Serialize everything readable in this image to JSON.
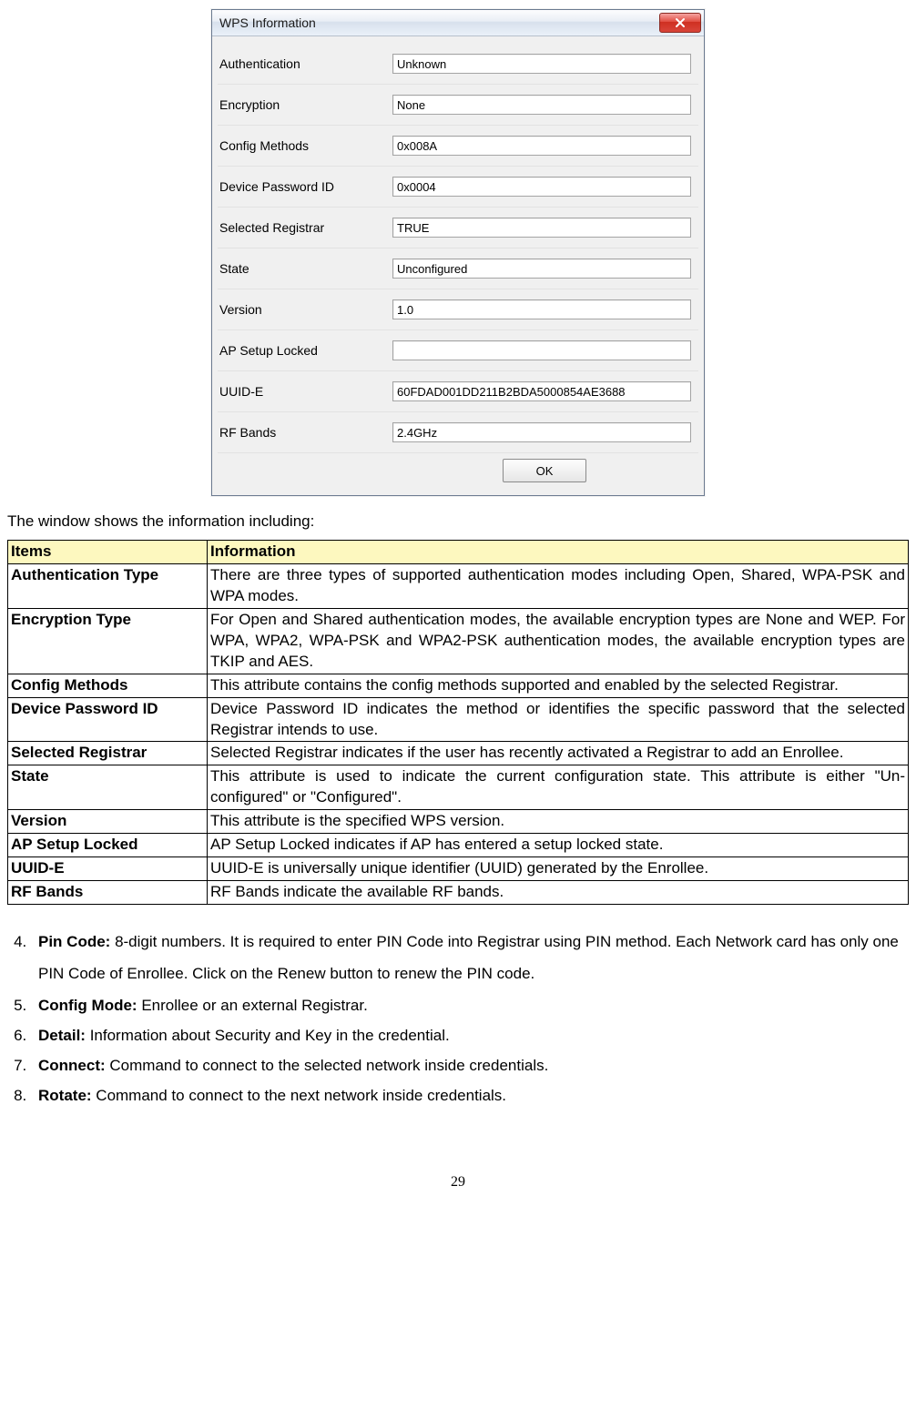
{
  "dialog": {
    "title": "WPS Information",
    "ok_label": "OK",
    "fields": [
      {
        "label": "Authentication",
        "value": "Unknown"
      },
      {
        "label": "Encryption",
        "value": "None"
      },
      {
        "label": "Config Methods",
        "value": "0x008A"
      },
      {
        "label": "Device Password ID",
        "value": "0x0004"
      },
      {
        "label": "Selected Registrar",
        "value": "TRUE"
      },
      {
        "label": "State",
        "value": "Unconfigured"
      },
      {
        "label": "Version",
        "value": "1.0"
      },
      {
        "label": "AP Setup Locked",
        "value": ""
      },
      {
        "label": "UUID-E",
        "value": "60FDAD001DD211B2BDA5000854AE3688"
      },
      {
        "label": "RF Bands",
        "value": "2.4GHz"
      }
    ]
  },
  "intro": "The window shows the information including:",
  "table": {
    "header_items": "Items",
    "header_info": "Information",
    "rows": [
      {
        "term": "Authentication Type",
        "desc": "There are three types of supported authentication modes including Open, Shared, WPA-PSK and WPA modes."
      },
      {
        "term": "Encryption Type",
        "desc": "For Open and Shared authentication modes, the available encryption types are None and WEP. For WPA, WPA2, WPA-PSK and WPA2-PSK authentication modes, the available encryption types are TKIP and AES."
      },
      {
        "term": "Config Methods",
        "desc": "This attribute contains the config methods supported and enabled by the selected Registrar."
      },
      {
        "term": "Device Password ID",
        "desc": "Device Password ID indicates the method or identifies the specific password that the selected Registrar intends to use."
      },
      {
        "term": "Selected Registrar",
        "desc": "Selected Registrar indicates if the user has recently activated a Registrar to add an Enrollee."
      },
      {
        "term": "State",
        "desc": "This attribute is used to indicate the current configuration state. This attribute is either \"Un-configured\" or \"Configured\"."
      },
      {
        "term": "Version",
        "desc": "This attribute is the specified WPS version."
      },
      {
        "term": "AP Setup Locked",
        "desc": "AP Setup Locked indicates if AP has entered a setup locked state."
      },
      {
        "term": "UUID-E",
        "desc": "UUID-E is universally unique identifier (UUID) generated by the Enrollee."
      },
      {
        "term": "RF Bands",
        "desc": "RF Bands indicate the available RF bands."
      }
    ]
  },
  "notes": [
    {
      "n": "4.",
      "title": "Pin Code:",
      "desc": " 8-digit numbers. It is required to enter PIN Code into Registrar using PIN method. Each Network card has only one PIN Code of Enrollee. Click on the Renew button to renew the PIN code."
    },
    {
      "n": "5.",
      "title": "Config Mode:",
      "desc": " Enrollee or an external Registrar."
    },
    {
      "n": "6.",
      "title": "Detail:",
      "desc": " Information about Security and Key in the credential."
    },
    {
      "n": "7.",
      "title": "Connect:",
      "desc": " Command to connect to the selected network inside credentials."
    },
    {
      "n": "8.",
      "title": "Rotate:",
      "desc": " Command to connect to the next network inside credentials."
    }
  ],
  "page_number": "29"
}
